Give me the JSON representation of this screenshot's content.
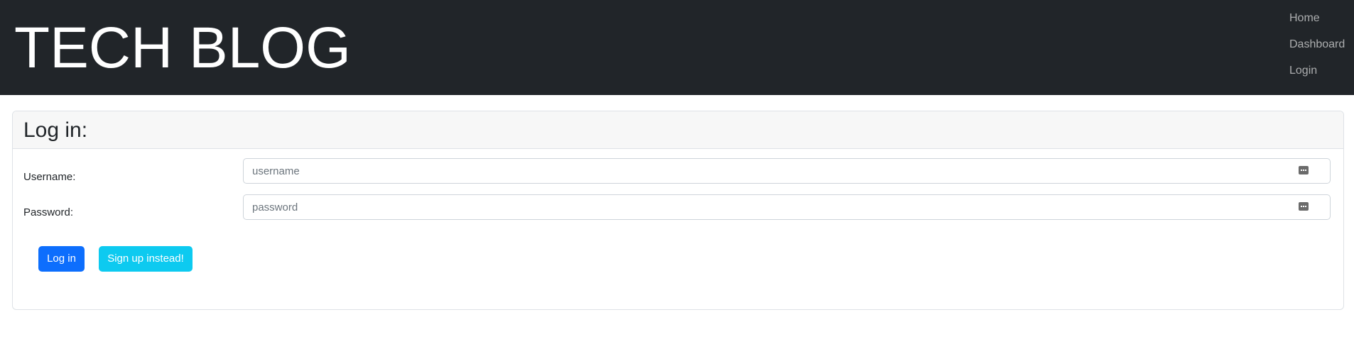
{
  "header": {
    "title": "TECH BLOG",
    "nav": [
      {
        "label": "Home"
      },
      {
        "label": "Dashboard"
      },
      {
        "label": "Login"
      }
    ]
  },
  "login_card": {
    "title": "Log in:",
    "username": {
      "label": "Username:",
      "value": "",
      "placeholder": "username",
      "icon": "password-manager-icon"
    },
    "password": {
      "label": "Password:",
      "value": "",
      "placeholder": "password",
      "icon": "password-manager-icon"
    },
    "login_button": "Log in",
    "signup_button": "Sign up instead!"
  },
  "colors": {
    "header_bg": "#212529",
    "primary": "#0d6efd",
    "info": "#0dcaf0",
    "card_header_bg": "#f7f7f7"
  }
}
